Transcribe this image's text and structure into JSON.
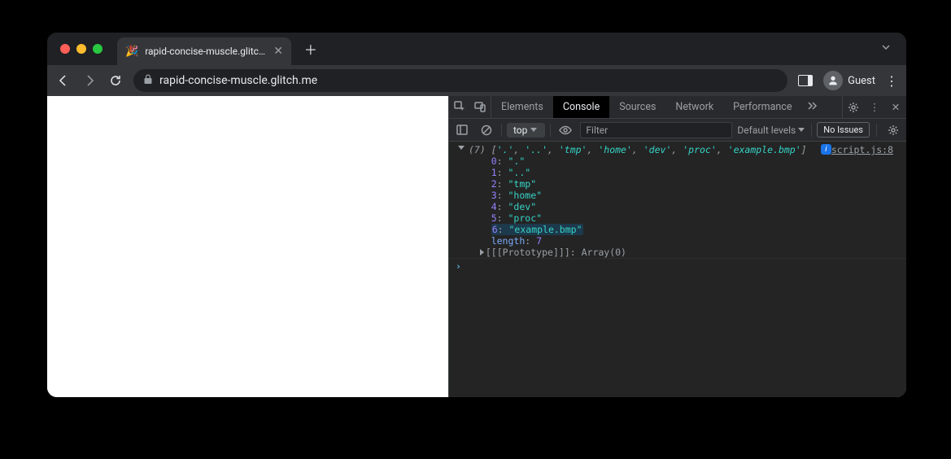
{
  "browser": {
    "tab_title": "rapid-concise-muscle.glitch.m",
    "url": "rapid-concise-muscle.glitch.me",
    "profile": "Guest"
  },
  "devtools": {
    "tabs": {
      "elements": "Elements",
      "console": "Console",
      "sources": "Sources",
      "network": "Network",
      "performance": "Performance"
    },
    "console_bar": {
      "context": "top",
      "filter_placeholder": "Filter",
      "levels": "Default levels",
      "issues": "No Issues"
    },
    "output": {
      "source_link": "script.js:8",
      "summary_count": "(7)",
      "summary_items": [
        "'.'",
        "'..'",
        "'tmp'",
        "'home'",
        "'dev'",
        "'proc'",
        "'example.bmp'"
      ],
      "entries": [
        {
          "index": "0",
          "value": "\".\""
        },
        {
          "index": "1",
          "value": "\"..\""
        },
        {
          "index": "2",
          "value": "\"tmp\""
        },
        {
          "index": "3",
          "value": "\"home\""
        },
        {
          "index": "4",
          "value": "\"dev\""
        },
        {
          "index": "5",
          "value": "\"proc\""
        },
        {
          "index": "6",
          "value": "\"example.bmp\"",
          "highlight": true
        }
      ],
      "length_label": "length",
      "length_value": "7",
      "proto_label": "[[Prototype]]",
      "proto_value": "Array(0)"
    }
  }
}
